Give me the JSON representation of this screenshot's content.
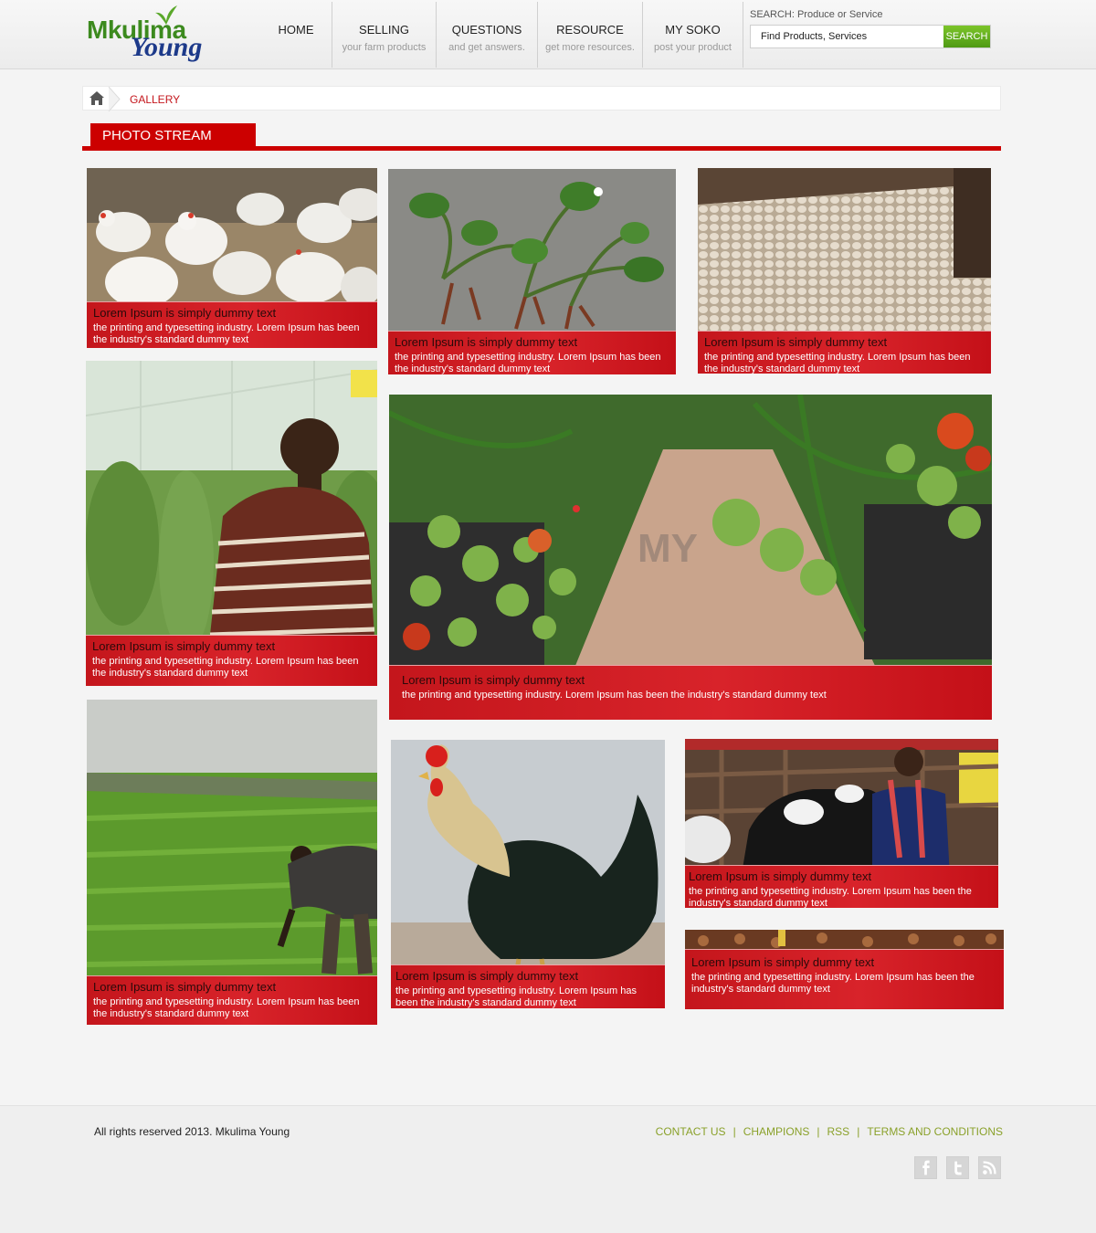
{
  "header": {
    "logo_top": "Mkulima",
    "logo_bottom": "Young",
    "nav": [
      {
        "title": "HOME",
        "sub": ""
      },
      {
        "title": "SELLING",
        "sub": "your farm products"
      },
      {
        "title": "QUESTIONS",
        "sub": "and get answers."
      },
      {
        "title": "RESOURCE",
        "sub": "get more resources."
      },
      {
        "title": "MY SOKO",
        "sub": "post your product"
      }
    ],
    "search": {
      "label": "SEARCH: Produce or Service",
      "placeholder": "Find Products, Services",
      "button": "SEARCH"
    }
  },
  "breadcrumb": {
    "current": "GALLERY"
  },
  "section": {
    "title": "PHOTO STREAM"
  },
  "tiles": [
    {
      "title": "Lorem Ipsum is simply dummy text",
      "text": "the printing and typesetting industry. Lorem Ipsum has been the industry's standard dummy text",
      "photo": "poultry-flock"
    },
    {
      "title": "Lorem Ipsum is simply dummy text",
      "text": "the printing and typesetting industry. Lorem Ipsum has been the industry's standard dummy text",
      "photo": "strawberry-seedlings"
    },
    {
      "title": "Lorem Ipsum is simply dummy text",
      "text": "the printing and typesetting industry. Lorem Ipsum has been the industry's standard dummy text",
      "photo": "egg-trays"
    },
    {
      "title": "Lorem Ipsum is simply dummy text",
      "text": "the printing and typesetting industry. Lorem Ipsum has been the industry's standard dummy text",
      "photo": "farmer-greenhouse"
    },
    {
      "title": "Lorem Ipsum is simply dummy text",
      "text": "the printing and typesetting industry. Lorem Ipsum has been  the industry's standard dummy text",
      "photo": "tomato-greenhouse",
      "watermark": "MY"
    },
    {
      "title": "Lorem Ipsum is simply dummy text",
      "text": "the printing and typesetting industry. Lorem Ipsum has been the industry's standard dummy text",
      "photo": "farmer-field"
    },
    {
      "title": "Lorem Ipsum is simply dummy text",
      "text": "the printing and typesetting industry. Lorem Ipsum has been the industry's standard dummy text",
      "photo": "rooster"
    },
    {
      "title": "Lorem Ipsum is simply dummy text",
      "text": "the printing and typesetting industry. Lorem Ipsum has been the industry's standard dummy text",
      "photo": "dairy-cows"
    },
    {
      "title": "Lorem Ipsum is simply dummy text",
      "text": "the printing and typesetting industry. Lorem Ipsum has been the industry's standard dummy text",
      "photo": "chicks"
    }
  ],
  "footer": {
    "copyright": "All rights reserved 2013. Mkulima Young",
    "links": [
      "CONTACT US",
      "CHAMPIONS",
      "RSS",
      "TERMS AND CONDITIONS"
    ],
    "link_separator": "|",
    "social": [
      "facebook-icon",
      "twitter-icon",
      "rss-icon"
    ]
  },
  "colors": {
    "brand_red": "#cc0000",
    "brand_green": "#3c8a1e",
    "link_green": "#8aa12a"
  }
}
